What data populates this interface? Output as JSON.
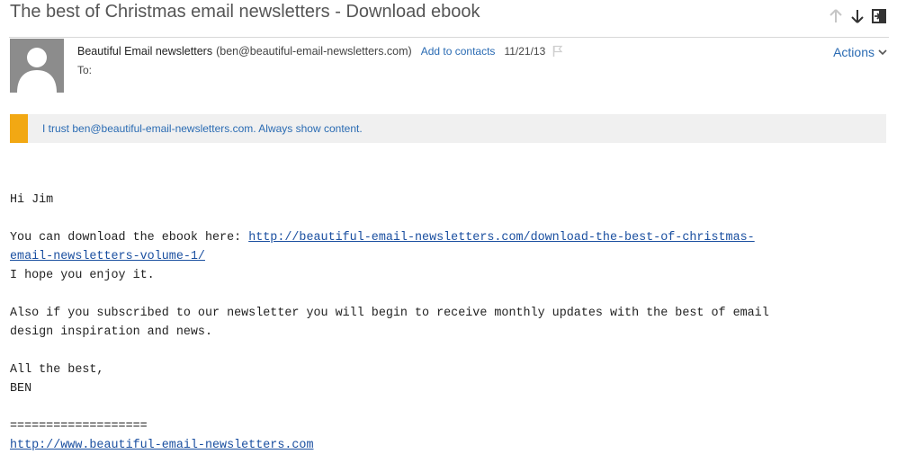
{
  "email": {
    "subject": "The best of Christmas email newsletters - Download ebook",
    "sender_name": "Beautiful Email newsletters",
    "sender_email": "(ben@beautiful-email-newsletters.com)",
    "add_contacts": "Add to contacts",
    "date": "11/21/13",
    "to_label": "To:",
    "actions_label": "Actions"
  },
  "trust_bar": {
    "text": "I trust ben@beautiful-email-newsletters.com. Always show content.",
    "accent_color": "#f2a813"
  },
  "body": {
    "greeting": "Hi Jim",
    "download_prefix": "You can download the ebook here: ",
    "download_link_line1": "http://beautiful-email-newsletters.com/download-the-best-of-christmas-",
    "download_link_line2": "email-newsletters-volume-1/",
    "enjoy": "I hope you enjoy it.",
    "also_line1": "Also if you subscribed to our newsletter you will begin to receive monthly updates with the best of email",
    "also_line2": "design inspiration and news.",
    "signoff": "All the best,",
    "signature": "BEN",
    "divider": "===================",
    "site_link": "http://www.beautiful-email-newsletters.com"
  },
  "icons": {
    "prev": "arrow-up-icon",
    "next": "arrow-down-icon",
    "popout": "popout-icon",
    "flag": "flag-icon",
    "actions_chevron": "chevron-down-icon"
  }
}
